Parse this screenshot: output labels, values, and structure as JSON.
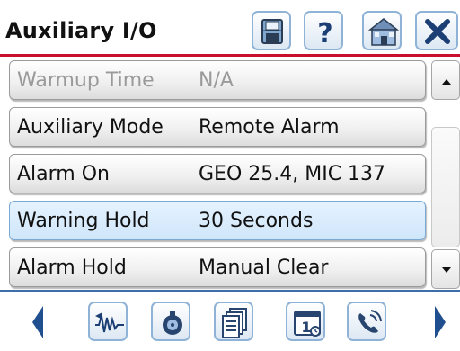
{
  "title": "Auxiliary I/O",
  "header_buttons": [
    {
      "name": "save",
      "icon": "save-disk-icon"
    },
    {
      "name": "help",
      "icon": "help-question-icon",
      "glyph": "?"
    },
    {
      "name": "home",
      "icon": "home-house-icon"
    },
    {
      "name": "close",
      "icon": "close-x-icon"
    }
  ],
  "rows": [
    {
      "label": "Warmup Time",
      "value": "N/A",
      "state": "disabled"
    },
    {
      "label": "Auxiliary Mode",
      "value": "Remote Alarm",
      "state": "normal"
    },
    {
      "label": "Alarm On",
      "value": "GEO 25.4, MIC 137",
      "state": "normal"
    },
    {
      "label": "Warning Hold",
      "value": "30 Seconds",
      "state": "selected"
    },
    {
      "label": "Alarm Hold",
      "value": "Manual Clear",
      "state": "normal"
    }
  ],
  "footer_buttons": [
    {
      "name": "signal",
      "icon": "waveform-signal-icon"
    },
    {
      "name": "sensor",
      "icon": "sensor-gauge-icon"
    },
    {
      "name": "documents",
      "icon": "documents-stack-icon"
    },
    {
      "name": "calendar",
      "icon": "calendar-day-icon",
      "glyph": "1"
    },
    {
      "name": "phone",
      "icon": "phone-call-icon"
    }
  ],
  "colors": {
    "accent_red": "#c8102e",
    "button_border": "#8fb3d6",
    "selected_row": "#d8ecfb",
    "arrow_blue": "#1f4f8f"
  }
}
